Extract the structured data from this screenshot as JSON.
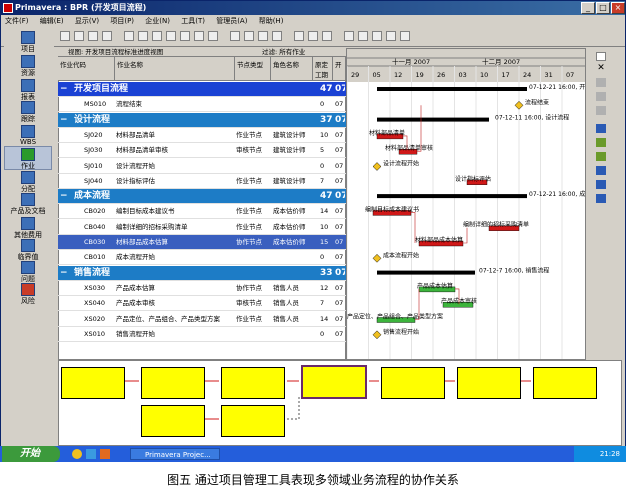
{
  "window": {
    "title": "Primavera : BPR (开发项目流程)",
    "minimize": "_",
    "maximize": "□",
    "close": "×"
  },
  "menubar": [
    "文件(F)",
    "编辑(E)",
    "显示(V)",
    "项目(P)",
    "企业(N)",
    "工具(T)",
    "管理员(A)",
    "帮助(H)"
  ],
  "leftnav": [
    "项目",
    "资源",
    "报表",
    "跟踪",
    "WBS",
    "作业",
    "分配",
    "产品及文档",
    "其他费用",
    "临界值",
    "问题",
    "风险"
  ],
  "grid": {
    "view_label": "视图: 开发项目流程标准进度视图",
    "filter_label": "过滤: 所有作业",
    "columns": [
      "作业代码",
      "作业名称",
      "节点类型",
      "角色名称",
      "原定工期",
      "开"
    ],
    "rows": [
      {
        "kind": "group0",
        "name": "开发项目流程",
        "dur": "47",
        "start": "07"
      },
      {
        "kind": "task",
        "code": "MS010",
        "name": "流程结束",
        "type": "",
        "role": "",
        "dur": "0",
        "start": "07"
      },
      {
        "kind": "group",
        "name": "设计流程",
        "dur": "37",
        "start": "07"
      },
      {
        "kind": "task",
        "code": "SJ020",
        "name": "材料部品清单",
        "type": "作业节点",
        "role": "建筑设计师",
        "dur": "10",
        "start": "07"
      },
      {
        "kind": "task",
        "code": "SJ030",
        "name": "材料部品清单审核",
        "type": "审核节点",
        "role": "建筑设计师",
        "dur": "5",
        "start": "07"
      },
      {
        "kind": "task",
        "code": "SJ010",
        "name": "设计流程开始",
        "type": "",
        "role": "",
        "dur": "0",
        "start": "07"
      },
      {
        "kind": "task",
        "code": "SJ040",
        "name": "设计指标评估",
        "type": "作业节点",
        "role": "建筑设计师",
        "dur": "7",
        "start": "07"
      },
      {
        "kind": "group",
        "name": "成本流程",
        "dur": "47",
        "start": "07"
      },
      {
        "kind": "task",
        "code": "CB020",
        "name": "编制目标成本建议书",
        "type": "作业节点",
        "role": "成本估价师",
        "dur": "14",
        "start": "07"
      },
      {
        "kind": "task",
        "code": "CB040",
        "name": "编制详细的招标采购清单",
        "type": "作业节点",
        "role": "成本估价师",
        "dur": "10",
        "start": "07"
      },
      {
        "kind": "sel",
        "code": "CB030",
        "name": "材料部品成本估算",
        "type": "协作节点",
        "role": "成本估价师",
        "dur": "15",
        "start": "07"
      },
      {
        "kind": "task",
        "code": "CB010",
        "name": "成本流程开始",
        "type": "",
        "role": "",
        "dur": "0",
        "start": "07"
      },
      {
        "kind": "group",
        "name": "销售流程",
        "dur": "33",
        "start": "07"
      },
      {
        "kind": "task",
        "code": "XS030",
        "name": "产品成本估算",
        "type": "协作节点",
        "role": "销售人员",
        "dur": "12",
        "start": "07"
      },
      {
        "kind": "task",
        "code": "XS040",
        "name": "产品成本审核",
        "type": "审核节点",
        "role": "销售人员",
        "dur": "7",
        "start": "07"
      },
      {
        "kind": "task",
        "code": "XS020",
        "name": "产品定位、产品组合、产品类型方案",
        "type": "作业节点",
        "role": "销售人员",
        "dur": "14",
        "start": "07"
      },
      {
        "kind": "task",
        "code": "XS010",
        "name": "销售流程开始",
        "type": "",
        "role": "",
        "dur": "0",
        "start": "07"
      }
    ]
  },
  "gantt": {
    "month1": "十一月 2007",
    "month2": "十二月 2007",
    "days": [
      "29",
      "05",
      "12",
      "19",
      "26",
      "03",
      "10",
      "17",
      "24",
      "31",
      "07"
    ],
    "labels": [
      {
        "text": "07-12-21 16:00, 开发"
      },
      {
        "text": "流程结束"
      },
      {
        "text": "07-12-11 16:00, 设计流程"
      },
      {
        "text": "材料部品清单"
      },
      {
        "text": "材料部品清单审核"
      },
      {
        "text": "设计流程开始"
      },
      {
        "text": "设计指标评估"
      },
      {
        "text": "07-12-21 16:00, 成本流"
      },
      {
        "text": "编制目标成本建议书"
      },
      {
        "text": "编制详细的招标采购清单"
      },
      {
        "text": "材料部品成本估算"
      },
      {
        "text": "成本流程开始"
      },
      {
        "text": "07-12-7 16:00, 销售流程"
      },
      {
        "text": "产品成本估算"
      },
      {
        "text": "产品成本审核"
      },
      {
        "text": "产品定位、产品组合、产品类型方案"
      },
      {
        "text": "销售流程开始"
      }
    ]
  },
  "taskbar": {
    "start": "开始",
    "app": "Primavera Projec...",
    "time": "21:28"
  },
  "caption": "图五  通过项目管理工具表现多领域业务流程的协作关系",
  "colors": {
    "title_bar": "#0a246a",
    "group_row": "#1d7cc6",
    "net_box": "#ffff00",
    "bar_red": "#d01818",
    "bar_green": "#3cb43c"
  }
}
